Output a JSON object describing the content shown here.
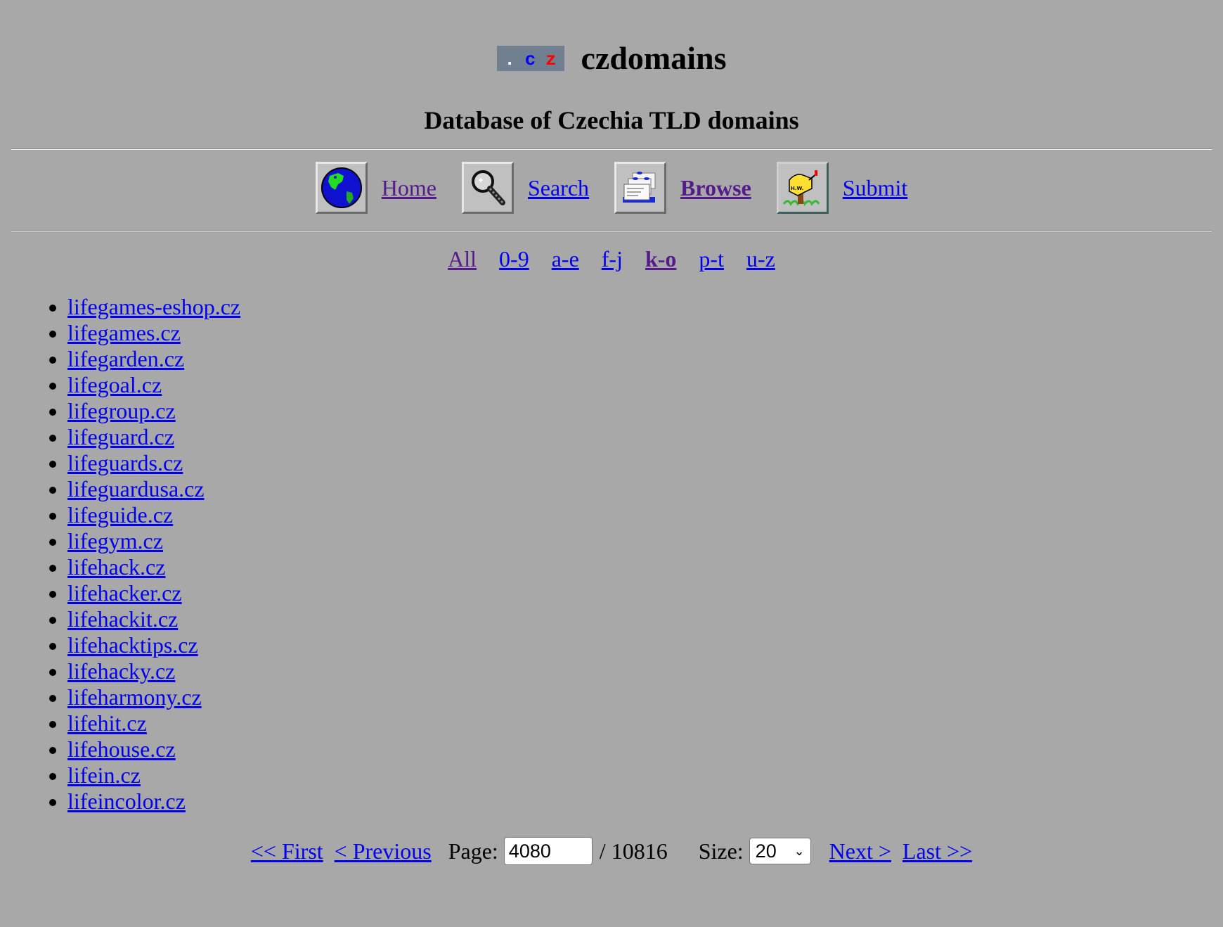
{
  "header": {
    "logo": {
      "dot": ".",
      "c": "c",
      "z": "z"
    },
    "site_name": "czdomains",
    "subtitle": "Database of Czechia TLD domains"
  },
  "nav": [
    {
      "label": "Home",
      "icon": "globe-icon",
      "visited": true,
      "bold": false
    },
    {
      "label": "Search",
      "icon": "magnifier-icon",
      "visited": false,
      "bold": false
    },
    {
      "label": "Browse",
      "icon": "card-file-icon",
      "visited": true,
      "bold": true
    },
    {
      "label": "Submit",
      "icon": "mailbox-icon",
      "visited": false,
      "bold": false
    }
  ],
  "letter_filters": [
    {
      "label": "All",
      "state": "visited"
    },
    {
      "label": "0-9",
      "state": "normal"
    },
    {
      "label": "a-e",
      "state": "normal"
    },
    {
      "label": "f-j",
      "state": "normal"
    },
    {
      "label": "k-o",
      "state": "current"
    },
    {
      "label": "p-t",
      "state": "normal"
    },
    {
      "label": "u-z",
      "state": "normal"
    }
  ],
  "domains": [
    "lifegames-eshop.cz",
    "lifegames.cz",
    "lifegarden.cz",
    "lifegoal.cz",
    "lifegroup.cz",
    "lifeguard.cz",
    "lifeguards.cz",
    "lifeguardusa.cz",
    "lifeguide.cz",
    "lifegym.cz",
    "lifehack.cz",
    "lifehacker.cz",
    "lifehackit.cz",
    "lifehacktips.cz",
    "lifehacky.cz",
    "lifeharmony.cz",
    "lifehit.cz",
    "lifehouse.cz",
    "lifein.cz",
    "lifeincolor.cz"
  ],
  "pager": {
    "first": "<< First",
    "previous": "< Previous",
    "page_label": "Page:",
    "page_value": "4080",
    "total": "/ 10816",
    "size_label": "Size:",
    "size_value": "20",
    "next": "Next >",
    "last": "Last >>"
  }
}
